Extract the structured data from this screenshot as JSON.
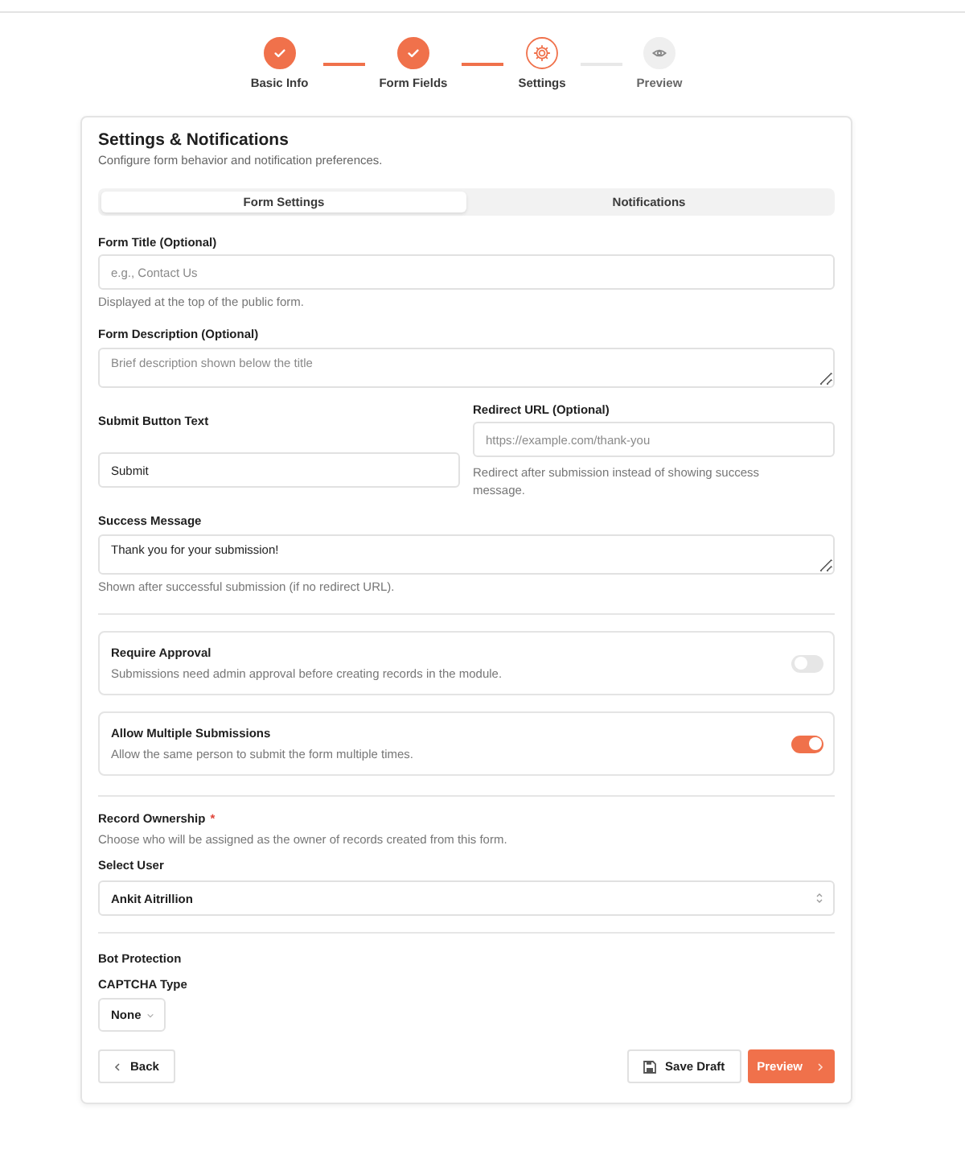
{
  "steps": [
    {
      "label": "Basic Info",
      "completed": true,
      "current": false
    },
    {
      "label": "Form Fields",
      "completed": true,
      "current": false
    },
    {
      "label": "Settings",
      "completed": false,
      "current": true
    },
    {
      "label": "Preview",
      "completed": false,
      "current": false
    }
  ],
  "panel": {
    "title": "Settings & Notifications",
    "subtitle": "Configure form behavior and notification preferences."
  },
  "tabs": [
    {
      "label": "Form Settings",
      "selected": true
    },
    {
      "label": "Notifications",
      "selected": false
    }
  ],
  "form_title": {
    "label": "Form Title (Optional)",
    "placeholder": "e.g., Contact Us",
    "hint": "Displayed at the top of the public form."
  },
  "form_description": {
    "label": "Form Description (Optional)",
    "placeholder": "Brief description shown below the title"
  },
  "submit_button_text": {
    "label": "Submit Button Text",
    "value": "Submit"
  },
  "redirect_url": {
    "label": "Redirect URL (Optional)",
    "placeholder": "https://example.com/thank-you",
    "hint": "Redirect after submission instead of showing success message."
  },
  "success_message": {
    "label": "Success Message",
    "value": "Thank you for your submission!",
    "hint": "Shown after successful submission (if no redirect URL)."
  },
  "toggles": [
    {
      "title": "Require Approval",
      "description": "Submissions need admin approval before creating records in the module.",
      "on": false
    },
    {
      "title": "Allow Multiple Submissions",
      "description": "Allow the same person to submit the form multiple times.",
      "on": true
    }
  ],
  "record_ownership": {
    "heading": "Record Ownership",
    "required_mark": "*",
    "description": "Choose who will be assigned as the owner of records created from this form.",
    "select_label": "Select User",
    "value": "Ankit Aitrillion"
  },
  "bot_protection": {
    "heading": "Bot Protection",
    "select_label": "CAPTCHA Type",
    "value": "None"
  },
  "actions": {
    "back": "Back",
    "save_draft": "Save Draft",
    "preview": "Preview"
  }
}
